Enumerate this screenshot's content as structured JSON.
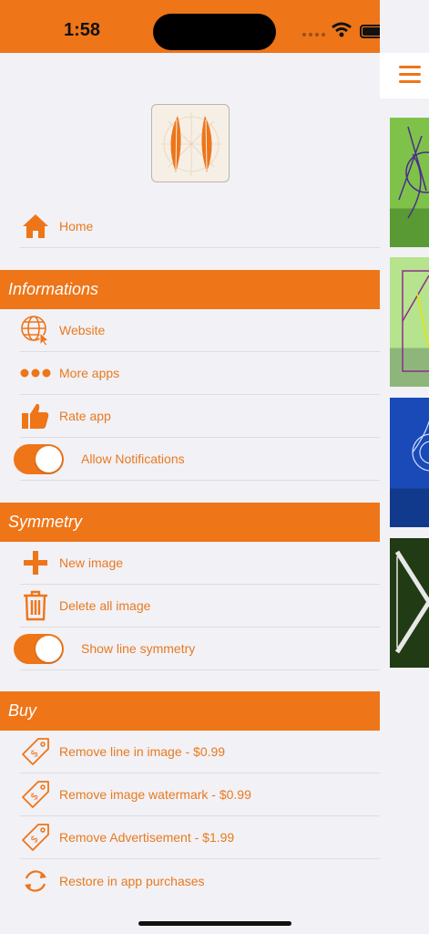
{
  "status": {
    "time": "1:58"
  },
  "colors": {
    "accent": "#ee7518",
    "background": "#f2f1f6"
  },
  "home": {
    "label": "Home",
    "icon": "home-icon"
  },
  "sections": {
    "informations": {
      "title": "Informations",
      "items": [
        {
          "label": "Website",
          "icon": "globe-cursor-icon"
        },
        {
          "label": "More apps",
          "icon": "more-dots-icon"
        },
        {
          "label": "Rate app",
          "icon": "thumbs-up-icon"
        }
      ],
      "toggle": {
        "label": "Allow Notifications",
        "on": true
      }
    },
    "symmetry": {
      "title": "Symmetry",
      "items": [
        {
          "label": "New image",
          "icon": "plus-icon"
        },
        {
          "label": "Delete all image",
          "icon": "trash-icon"
        }
      ],
      "toggle": {
        "label": "Show line symmetry",
        "on": true
      }
    },
    "buy": {
      "title": "Buy",
      "items": [
        {
          "label": "Remove line in image - $0.99",
          "icon": "price-tag-icon"
        },
        {
          "label": "Remove image watermark - $0.99",
          "icon": "price-tag-icon"
        },
        {
          "label": "Remove Advertisement - $1.99",
          "icon": "price-tag-icon"
        },
        {
          "label": "Restore in app purchases",
          "icon": "restore-icon"
        }
      ]
    }
  }
}
